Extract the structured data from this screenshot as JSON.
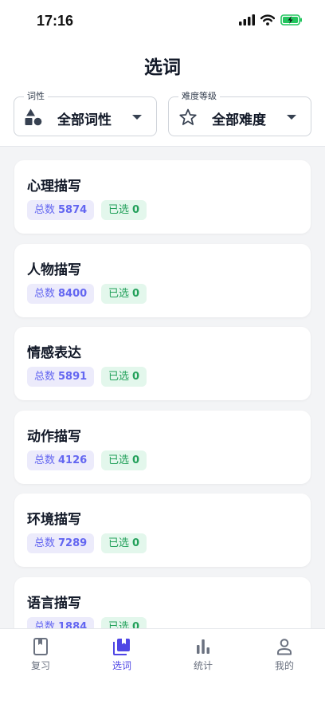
{
  "status": {
    "time": "17:16"
  },
  "header": {
    "title": "选词"
  },
  "filters": {
    "part_of_speech": {
      "legend": "词性",
      "value": "全部词性",
      "icon": "shapes-icon"
    },
    "difficulty": {
      "legend": "难度等级",
      "value": "全部难度",
      "icon": "star-outline-icon"
    }
  },
  "labels": {
    "total": "总数",
    "selected": "已选"
  },
  "categories": [
    {
      "title": "心理描写",
      "total": "5874",
      "selected": "0"
    },
    {
      "title": "人物描写",
      "total": "8400",
      "selected": "0"
    },
    {
      "title": "情感表达",
      "total": "5891",
      "selected": "0"
    },
    {
      "title": "动作描写",
      "total": "4126",
      "selected": "0"
    },
    {
      "title": "环境描写",
      "total": "7289",
      "selected": "0"
    },
    {
      "title": "语言描写",
      "total": "1884",
      "selected": "0"
    }
  ],
  "tabs": [
    {
      "label": "复习",
      "icon": "book-icon",
      "active": false
    },
    {
      "label": "选词",
      "icon": "library-books-icon",
      "active": true
    },
    {
      "label": "统计",
      "icon": "bar-chart-icon",
      "active": false
    },
    {
      "label": "我的",
      "icon": "person-icon",
      "active": false
    }
  ],
  "colors": {
    "accent": "#4f46e5",
    "total_badge_bg": "#ecebfb",
    "selected_badge_bg": "#e3f7ec",
    "selected_badge_text": "#22a05a"
  }
}
